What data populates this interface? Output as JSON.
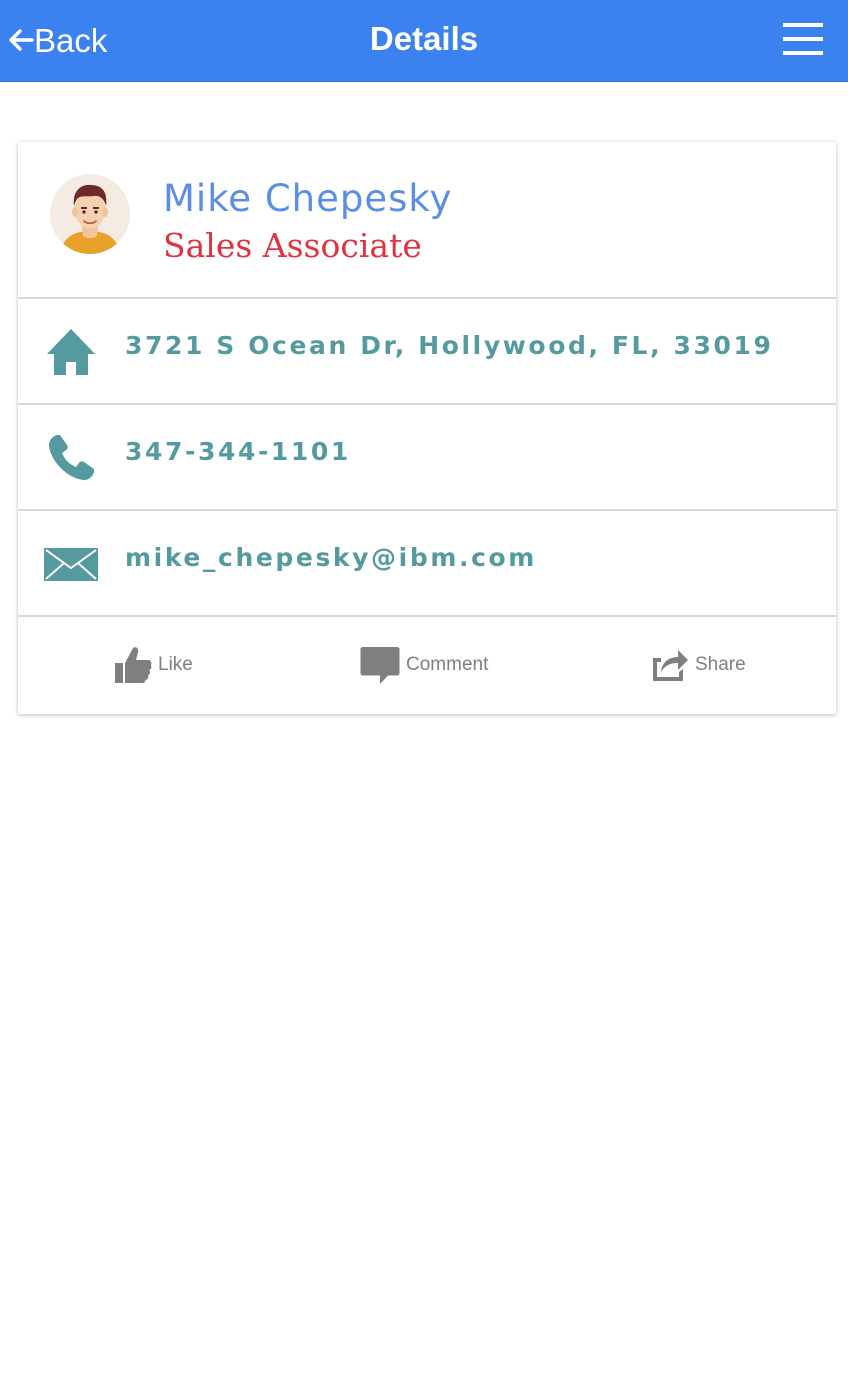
{
  "header": {
    "back_label": "Back",
    "title": "Details"
  },
  "profile": {
    "name": "Mike Chepesky",
    "job_title": "Sales Associate"
  },
  "contact": {
    "address": "3721 S Ocean Dr, Hollywood, FL, 33019",
    "phone": "347-344-1101",
    "email": "mike_chepesky@ibm.com"
  },
  "actions": {
    "like": "Like",
    "comment": "Comment",
    "share": "Share"
  },
  "icons": [
    "back-arrow-icon",
    "hamburger-menu-icon",
    "avatar",
    "home-icon",
    "phone-icon",
    "envelope-icon",
    "thumbs-up-icon",
    "comment-icon",
    "share-icon"
  ],
  "colors": {
    "header_bg": "#3b82f0",
    "name": "#5b8ee6",
    "job_title": "#e0333f",
    "contact_text": "#559a9e",
    "action_text": "#7f7f7f"
  }
}
